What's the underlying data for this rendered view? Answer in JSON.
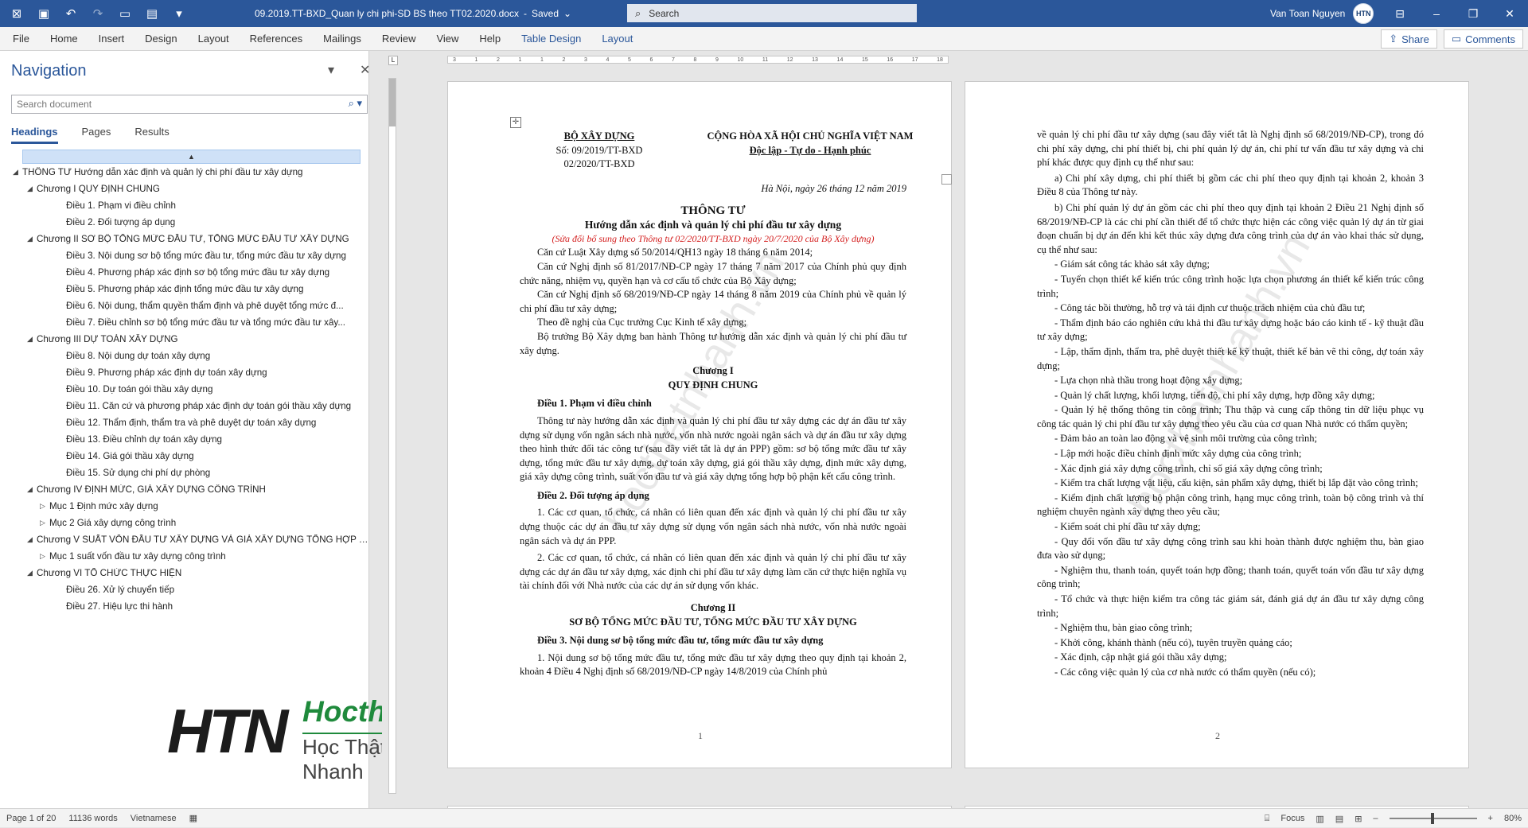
{
  "titlebar": {
    "doc_name": "09.2019.TT-BXD_Quan ly chi phi-SD BS theo TT02.2020.docx",
    "status": "Saved",
    "search_placeholder": "Search",
    "user_name": "Van Toan Nguyen",
    "avatar_text": "HTN"
  },
  "ribbon": {
    "tabs": [
      "File",
      "Home",
      "Insert",
      "Design",
      "Layout",
      "References",
      "Mailings",
      "Review",
      "View",
      "Help",
      "Table Design",
      "Layout"
    ],
    "accent_tabs": [
      "Table Design",
      "Layout"
    ],
    "share_label": "Share",
    "comments_label": "Comments"
  },
  "navigation": {
    "title": "Navigation",
    "search_placeholder": "Search document",
    "tabs": [
      "Headings",
      "Pages",
      "Results"
    ],
    "active_tab": "Headings",
    "items": [
      {
        "level": 0,
        "expanded": true,
        "text": "THÔNG TƯ Hướng dẫn xác định và quản lý chi phí đầu tư xây dựng"
      },
      {
        "level": 1,
        "expanded": true,
        "text": "Chương I QUY ĐỊNH CHUNG"
      },
      {
        "level": 2,
        "text": "Điều 1. Phạm vi điều chỉnh"
      },
      {
        "level": 2,
        "text": "Điều 2. Đối tượng áp dụng"
      },
      {
        "level": 1,
        "expanded": true,
        "text": "Chương II SƠ BỘ TỔNG MỨC ĐẦU TƯ, TỔNG MỨC ĐẦU TƯ XÂY DỰNG"
      },
      {
        "level": 2,
        "text": "Điều 3. Nội dung sơ bộ tổng mức đầu tư, tổng mức đầu tư xây dựng"
      },
      {
        "level": 2,
        "text": "Điều 4. Phương pháp xác định sơ bộ tổng mức đầu tư xây dựng"
      },
      {
        "level": 2,
        "text": "Điều 5. Phương pháp xác định tổng mức đầu tư xây dựng"
      },
      {
        "level": 2,
        "text": "Điều 6. Nội dung, thẩm quyền thẩm định và phê duyệt tổng mức đ..."
      },
      {
        "level": 2,
        "text": "Điều 7. Điều chỉnh sơ bộ tổng mức đầu tư và tổng mức đầu tư xây..."
      },
      {
        "level": 1,
        "expanded": true,
        "text": "Chương III DỰ TOÁN XÂY DỰNG"
      },
      {
        "level": 2,
        "text": "Điều 8. Nội dung dự toán xây dựng"
      },
      {
        "level": 2,
        "text": "Điều 9. Phương pháp xác định dự toán xây dựng"
      },
      {
        "level": 2,
        "text": "Điều 10. Dự toán gói thầu xây dựng"
      },
      {
        "level": 2,
        "text": "Điều 11. Căn cứ và phương pháp xác định dự toán gói thầu xây dựng"
      },
      {
        "level": 2,
        "text": "Điều 12. Thẩm định, thẩm tra và phê duyệt dự toán xây dựng"
      },
      {
        "level": 2,
        "text": "Điều 13. Điều chỉnh dự toán xây dựng"
      },
      {
        "level": 2,
        "text": "Điều 14. Giá gói thầu xây dựng"
      },
      {
        "level": 2,
        "text": "Điều 15. Sử dụng chi phí dự phòng"
      },
      {
        "level": 1,
        "expanded": true,
        "text": "Chương IV ĐỊNH MỨC, GIÁ XÂY DỰNG CÔNG TRÌNH"
      },
      {
        "level": 3,
        "expanded": false,
        "text": "Mục 1 Định mức xây dựng"
      },
      {
        "level": 3,
        "expanded": false,
        "text": "Mục 2 Giá xây dựng công trình"
      },
      {
        "level": 1,
        "expanded": true,
        "text": "Chương V SUẤT VỐN ĐẦU TƯ XÂY DỰNG VÀ GIÁ XÂY DỰNG TỔNG HỢP B..."
      },
      {
        "level": 3,
        "expanded": false,
        "text": "Mục 1 suất vốn đầu tư xây dựng công trình"
      },
      {
        "level": 1,
        "expanded": true,
        "text": "Chương VI TỔ CHỨC THỰC HIỆN"
      },
      {
        "level": 2,
        "text": "Điều 26. Xử lý chuyển tiếp"
      },
      {
        "level": 2,
        "text": "Điều 27. Hiệu lực thi hành"
      }
    ]
  },
  "logo": {
    "site": "Hocthatnhanh.vn",
    "slogan": "Học Thật - Làm Nhanh"
  },
  "page1": {
    "ministry": "BỘ XÂY DỰNG",
    "number_line1": "Số: 09/2019/TT-BXD",
    "number_line2": "02/2020/TT-BXD",
    "republic": "CỘNG HÒA XÃ HỘI CHỦ NGHĨA VIỆT NAM",
    "motto": "Độc lập - Tự do - Hạnh phúc",
    "date": "Hà Nội, ngày 26 tháng 12 năm 2019",
    "doc_type": "THÔNG TƯ",
    "doc_title": "Hướng dẫn xác định và quản lý chi phí đầu tư xây dựng",
    "amend_note": "(Sửa đổi bổ sung theo Thông tư 02/2020/TT-BXD ngày 20/7/2020 của Bộ Xây dựng)",
    "paragraphs": [
      "Căn cứ Luật Xây dựng số 50/2014/QH13 ngày 18 tháng 6 năm 2014;",
      "Căn cứ Nghị định số 81/2017/NĐ-CP ngày 17 tháng 7 năm 2017 của Chính phủ quy định chức năng, nhiệm vụ, quyền hạn và cơ cấu tổ chức của Bộ Xây dựng;",
      "Căn cứ Nghị định số 68/2019/NĐ-CP ngày 14 tháng 8 năm 2019 của Chính phủ về quản lý chi phí đầu tư xây dựng;",
      "Theo đề nghị của Cục trưởng Cục Kinh tế xây dựng;",
      "Bộ trưởng Bộ Xây dựng ban hành Thông tư hướng dẫn xác định và quản lý chi phí đầu tư xây dựng."
    ],
    "chapter1": "Chương I",
    "chapter1_title": "QUY ĐỊNH CHUNG",
    "art1": "Điều 1. Phạm vi điều chỉnh",
    "art1_text": "Thông tư này hướng dẫn xác định và quản lý chi phí đầu tư xây dựng các dự án đầu tư xây dựng sử dụng vốn ngân sách nhà nước, vốn nhà nước ngoài ngân sách và dự án đầu tư xây dựng theo hình thức đối tác công tư (sau đây viết tắt là dự án PPP) gồm: sơ bộ tổng mức đầu tư xây dựng, tổng mức đầu tư xây dựng, dự toán xây dựng, giá gói thầu xây dựng, định mức xây dựng, giá xây dựng công trình, suất vốn đầu tư và giá xây dựng tổng hợp bộ phận kết cấu công trình.",
    "art2": "Điều 2. Đối tượng áp dụng",
    "art2_p1": "1. Các cơ quan, tổ chức, cá nhân có liên quan đến xác định và quản lý chi phí đầu tư xây dựng thuộc các dự án đầu tư xây dựng sử dụng vốn ngân sách nhà nước, vốn nhà nước ngoài ngân sách và dự án PPP.",
    "art2_p2": "2. Các cơ quan, tổ chức, cá nhân có liên quan đến xác định và quản lý chi phí đầu tư xây dựng các dự án đầu tư xây dựng, xác định chi phí đầu tư xây dựng làm căn cứ thực hiện nghĩa vụ tài chính đối với Nhà nước của các dự án sử dụng vốn khác.",
    "chapter2": "Chương II",
    "chapter2_title": "SƠ BỘ TỔNG MỨC ĐẦU TƯ, TỔNG MỨC ĐẦU TƯ XÂY DỰNG",
    "art3": "Điều 3. Nội dung sơ bộ tổng mức đầu tư, tổng mức đầu tư xây dựng",
    "art3_text": "1. Nội dung sơ bộ tổng mức đầu tư, tổng mức đầu tư xây dựng theo quy định tại khoản 2, khoản 4 Điều 4 Nghị định số 68/2019/NĐ-CP ngày 14/8/2019 của Chính phủ",
    "page_number": "1",
    "watermark": "hocthatnhanh.vn"
  },
  "page2": {
    "intro": "về quản lý chi phí đầu tư xây dựng (sau đây viết tắt là Nghị định số 68/2019/NĐ-CP), trong đó chi phí xây dựng, chi phí thiết bị, chi phí quản lý dự án, chi phí tư vấn đầu tư xây dựng và chi phí khác được quy định cụ thể như sau:",
    "a": "a) Chi phí xây dựng, chi phí thiết bị gồm các chi phí theo quy định tại khoản 2, khoản 3 Điều 8 của Thông tư này.",
    "b": "b) Chi phí quản lý dự án gồm các chi phí theo quy định tại khoản 2 Điều 21 Nghị định số 68/2019/NĐ-CP là các chi phí cần thiết để tổ chức thực hiện các công việc quản lý dự án từ giai đoạn chuẩn bị dự án đến khi kết thúc xây dựng đưa công trình của dự án vào khai thác sử dụng, cụ thể như sau:",
    "items": [
      "- Giám sát công tác khảo sát xây dựng;",
      "- Tuyển chọn thiết kế kiến trúc công trình hoặc lựa chọn phương án thiết kế kiến trúc công trình;",
      "- Công tác bồi thường, hỗ trợ và tái định cư thuộc trách nhiệm của chủ đầu tư;",
      "- Thẩm định báo cáo nghiên cứu khả thi đầu tư xây dựng hoặc báo cáo kinh tế - kỹ thuật đầu tư xây dựng;",
      "- Lập, thẩm định, thẩm tra, phê duyệt thiết kế kỹ thuật, thiết kế bản vẽ thi công, dự toán xây dựng;",
      "- Lựa chọn nhà thầu trong hoạt động xây dựng;",
      "- Quản lý chất lượng, khối lượng, tiến độ, chi phí xây dựng, hợp đồng xây dựng;",
      "- Quản lý hệ thống thông tin công trình; Thu thập và cung cấp thông tin dữ liệu phục vụ công tác quản lý chi phí đầu tư xây dựng theo yêu cầu của cơ quan Nhà nước có thẩm quyền;",
      "- Đảm bảo an toàn lao động và vệ sinh môi trường của công trình;",
      "- Lập mới hoặc điều chỉnh định mức xây dựng của công trình;",
      "- Xác định giá xây dựng công trình, chỉ số giá xây dựng công trình;",
      "- Kiểm tra chất lượng vật liệu, cấu kiện, sản phẩm xây dựng, thiết bị lắp đặt vào công trình;",
      "- Kiểm định chất lượng bộ phận công trình, hạng mục công trình, toàn bộ công trình và thí nghiệm chuyên ngành xây dựng theo yêu cầu;",
      "- Kiểm soát chi phí đầu tư xây dựng;",
      "- Quy đổi vốn đầu tư xây dựng công trình sau khi hoàn thành được nghiệm thu, bàn giao đưa vào sử dụng;",
      "- Nghiệm thu, thanh toán, quyết toán hợp đồng; thanh toán, quyết toán vốn đầu tư xây dựng công trình;",
      "- Tổ chức và thực hiện kiểm tra công tác giám sát, đánh giá dự án đầu tư xây dựng công trình;",
      "- Nghiệm thu, bàn giao công trình;",
      "- Khởi công, khánh thành (nếu có), tuyên truyền quảng cáo;",
      "- Xác định, cập nhật giá gói thầu xây dựng;",
      "- Các công việc quản lý của cơ nhà nước có thẩm quyền (nếu có);"
    ],
    "page_number": "2",
    "watermark": "hocthatnhanh.vn"
  },
  "ruler": {
    "ticks": [
      "3",
      "1",
      "2",
      "1",
      "1",
      "2",
      "3",
      "4",
      "5",
      "6",
      "7",
      "8",
      "9",
      "10",
      "11",
      "12",
      "13",
      "14",
      "15",
      "16",
      "17",
      "18"
    ],
    "v_ticks": [
      "21",
      "22",
      "23",
      "24",
      "25",
      "26",
      "27"
    ]
  },
  "statusbar": {
    "page": "Page 1 of 20",
    "words": "11136 words",
    "language": "Vietnamese",
    "focus": "Focus",
    "zoom": "80%"
  }
}
